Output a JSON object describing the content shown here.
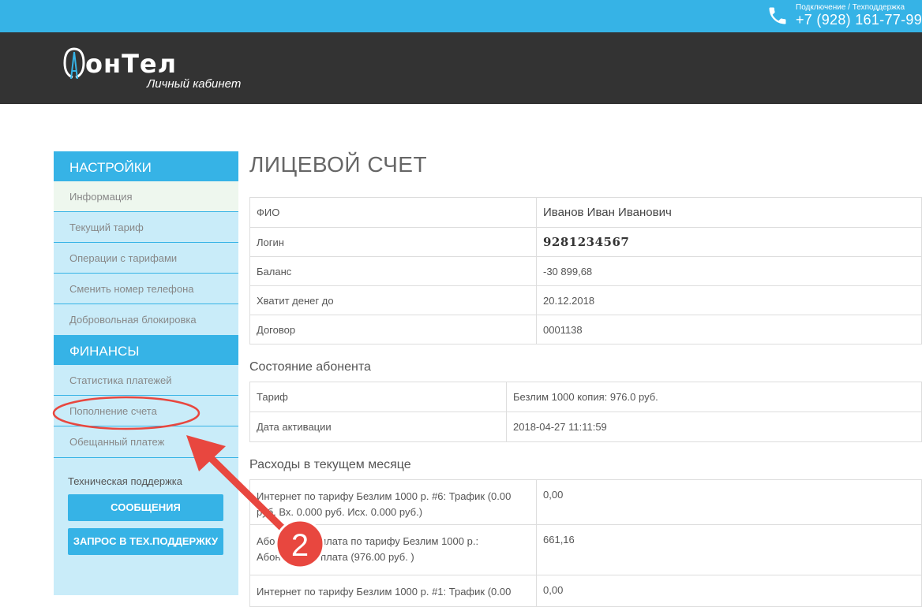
{
  "topbar": {
    "caption": "Подключение / Техподдержка",
    "phone": "+7 (928) 161-77-99",
    "phone_icon": "phone-icon",
    "color": "#36b3e6"
  },
  "header": {
    "logo_text": "онТел",
    "logo_sub": "Личный кабинет"
  },
  "sidebar": {
    "settings_title": "НАСТРОЙКИ",
    "settings_items": [
      {
        "label": "Информация"
      },
      {
        "label": "Текущий тариф"
      },
      {
        "label": "Операции с тарифами"
      },
      {
        "label": "Сменить номер телефона"
      },
      {
        "label": "Добровольная блокировка"
      }
    ],
    "finance_title": "ФИНАНСЫ",
    "finance_items": [
      {
        "label": "Статистика платежей"
      },
      {
        "label": "Пополнение счета"
      },
      {
        "label": "Обещанный платеж"
      }
    ],
    "support_label": "Техническая поддержка",
    "messages_button": "СООБЩЕНИЯ",
    "ticket_button": "ЗАПРОС В ТЕХ.ПОДДЕРЖКУ"
  },
  "main": {
    "title": "ЛИЦЕВОЙ СЧЕТ",
    "account": [
      {
        "key": "ФИО",
        "value": "Иванов Иван Иванович"
      },
      {
        "key": "Логин",
        "value": "9281234567"
      },
      {
        "key": "Баланс",
        "value": "-30 899,68"
      },
      {
        "key": "Хватит денег до",
        "value": "20.12.2018"
      },
      {
        "key": "Договор",
        "value": "0001138"
      }
    ],
    "status_title": "Состояние абонента",
    "status": [
      {
        "key": "Тариф",
        "value": "Безлим 1000 копия: 976.0 руб."
      },
      {
        "key": "Дата активации",
        "value": "2018-04-27 11:11:59"
      }
    ],
    "expenses_title": "Расходы в текущем месяце",
    "expenses": [
      {
        "key": "Интернет по тарифу Безлим 1000 р. #6: Трафик (0.00 руб. Вх. 0.000 руб. Исх. 0.000 руб.)",
        "value": "0,00"
      },
      {
        "key": "Абонентская плата по тарифу Безлим 1000 р.: Абонентская плата (976.00 руб. )",
        "value": "661,16"
      },
      {
        "key": "Интернет по тарифу Безлим 1000 р. #1: Трафик (0.00",
        "value": "0,00"
      }
    ]
  },
  "annotation": {
    "step_number": "2",
    "arrow_color": "#e8473f"
  }
}
